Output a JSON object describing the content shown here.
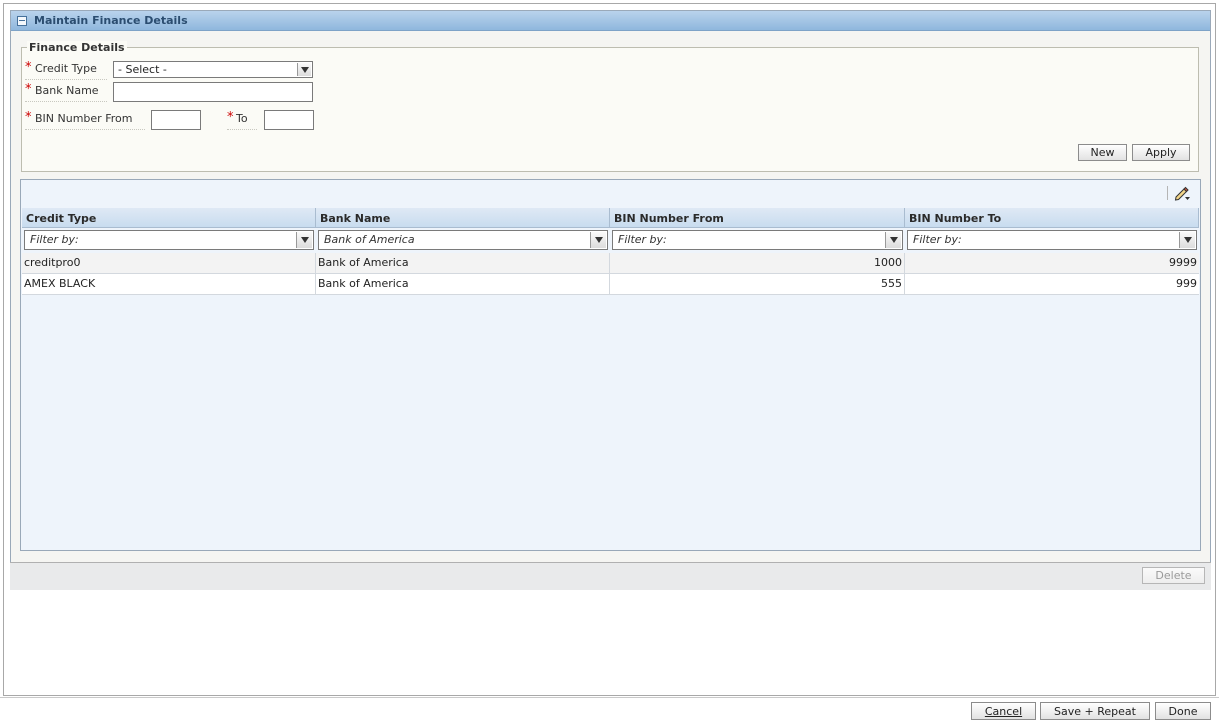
{
  "panel": {
    "title": "Maintain Finance Details"
  },
  "form": {
    "legend": "Finance Details",
    "credit_type_label": "Credit Type",
    "credit_type_value": "- Select -",
    "bank_name_label": "Bank Name",
    "bank_name_value": "",
    "bin_from_label": "BIN Number From",
    "bin_from_value": "",
    "bin_to_label": "To",
    "bin_to_value": "",
    "new_label": "New",
    "apply_label": "Apply"
  },
  "table": {
    "columns": [
      "Credit Type",
      "Bank Name",
      "BIN Number From",
      "BIN Number To"
    ],
    "filters": [
      "Filter by:",
      "Bank of America",
      "Filter by:",
      "Filter by:"
    ],
    "rows": [
      [
        "creditpro0",
        "Bank of America",
        "1000",
        "9999"
      ],
      [
        "AMEX BLACK",
        "Bank of America",
        "555",
        "999"
      ]
    ],
    "delete_label": "Delete",
    "edit_icon": "pencil-edit-icon"
  },
  "footer": {
    "cancel_label": "Cancel",
    "save_repeat_label": "Save + Repeat",
    "done_label": "Done"
  },
  "colors": {
    "header_blue": "#8fb7dd",
    "grid_background": "#eef4fb",
    "required_red": "#cc0000"
  }
}
